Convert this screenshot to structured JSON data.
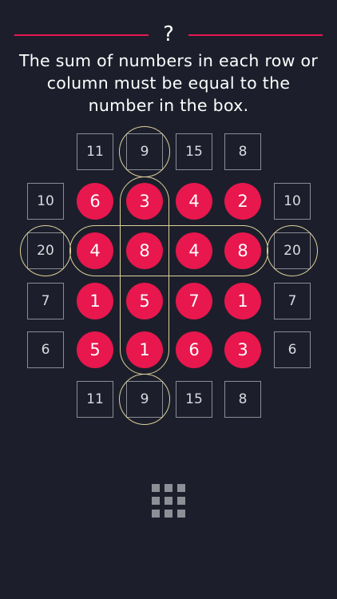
{
  "header": {
    "help_label": "?",
    "instructions": [
      "The sum of numbers in each row or",
      "column must be equal to the",
      "number in the box."
    ],
    "accent_color": "#e6194f"
  },
  "puzzle": {
    "column_sums_top": [
      "11",
      "9",
      "15",
      "8"
    ],
    "column_sums_bottom": [
      "11",
      "9",
      "15",
      "8"
    ],
    "row_sums_left": [
      "10",
      "20",
      "7",
      "6"
    ],
    "row_sums_right": [
      "10",
      "20",
      "7",
      "6"
    ],
    "grid": [
      [
        "6",
        "3",
        "4",
        "2"
      ],
      [
        "4",
        "8",
        "4",
        "8"
      ],
      [
        "1",
        "5",
        "7",
        "1"
      ],
      [
        "5",
        "1",
        "6",
        "3"
      ]
    ],
    "highlighted_row": 1,
    "highlighted_column": 2,
    "cell_color": "#e8174e",
    "highlight_color": "#ddd09a"
  },
  "footer": {
    "menu_icon": "grid-menu-icon"
  }
}
